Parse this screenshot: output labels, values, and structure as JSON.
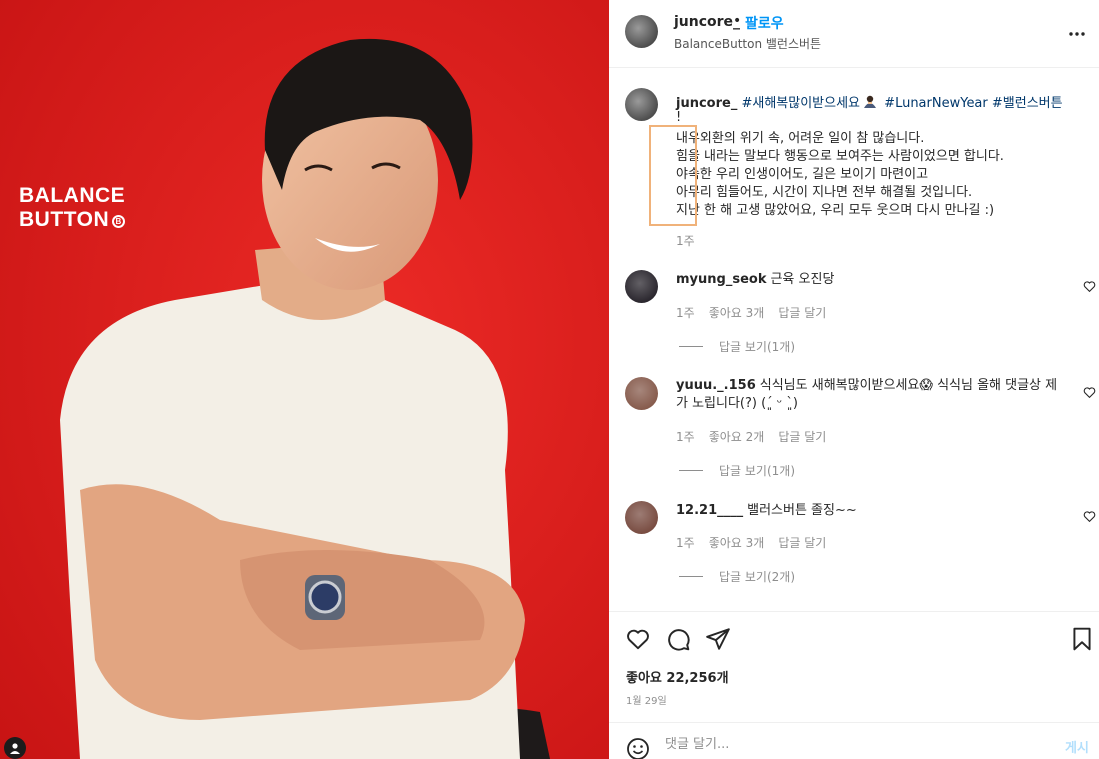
{
  "photo": {
    "brand_line1": "BALANCE",
    "brand_line2": "BUTTON",
    "brand_badge": "B",
    "background_color": "#e4201f"
  },
  "header": {
    "username": "juncore_",
    "separator": "•",
    "follow_label": "팔로우",
    "subtitle": "BalanceButton 밸런스버튼",
    "more_icon": "more-horizontal-icon"
  },
  "caption": {
    "username": "juncore_",
    "hashtag1": "#새해복많이받으세요",
    "emoji_icon": "bowing-person-emoji",
    "hashtag2": "#LunarNewYear",
    "hashtag3": "#밸런스버튼",
    "bang": "!",
    "lines": [
      "내우외환의 위기 속, 어려운 일이 참 많습니다.",
      "힘을 내라는 말보다 행동으로 보여주는 사람이었으면 합니다.",
      "야속한 우리 인생이어도, 길은 보이기 마련이고",
      "아무리 힘들어도, 시간이 지나면 전부 해결될 것입니다.",
      "지난 한 해 고생 많았어요, 우리 모두 웃으며 다시 만나길 :)"
    ],
    "time": "1주"
  },
  "comments": [
    {
      "username": "myung_seok",
      "text": "근육 오진당",
      "time": "1주",
      "likes": "좋아요 3개",
      "reply": "답글 달기",
      "view_replies": "답글 보기(1개)",
      "avatar_color": "#141018"
    },
    {
      "username": "yuuu._.156",
      "text": "식식님도 새해복많이받으세요😱 식식님 올해 댓글상 제가 노립니다(?) (´͈ ᵕ `͈)",
      "time": "1주",
      "likes": "좋아요 2개",
      "reply": "답글 달기",
      "view_replies": "답글 보기(1개)",
      "avatar_color": "#7a4a3a"
    },
    {
      "username": "12.21____",
      "text": "밸러스버튼 졸징~~",
      "time": "1주",
      "likes": "좋아요 3개",
      "reply": "답글 달기",
      "view_replies": "답글 보기(2개)",
      "avatar_color": "#6b3a2e"
    }
  ],
  "actions": {
    "like_icon": "heart-icon",
    "comment_icon": "comment-icon",
    "share_icon": "send-icon",
    "save_icon": "bookmark-icon",
    "likes_text": "좋아요 22,256개",
    "date": "1월 29일"
  },
  "add_comment": {
    "emoji_icon": "smiley-icon",
    "placeholder": "댓글 달기...",
    "post_label": "게시"
  }
}
